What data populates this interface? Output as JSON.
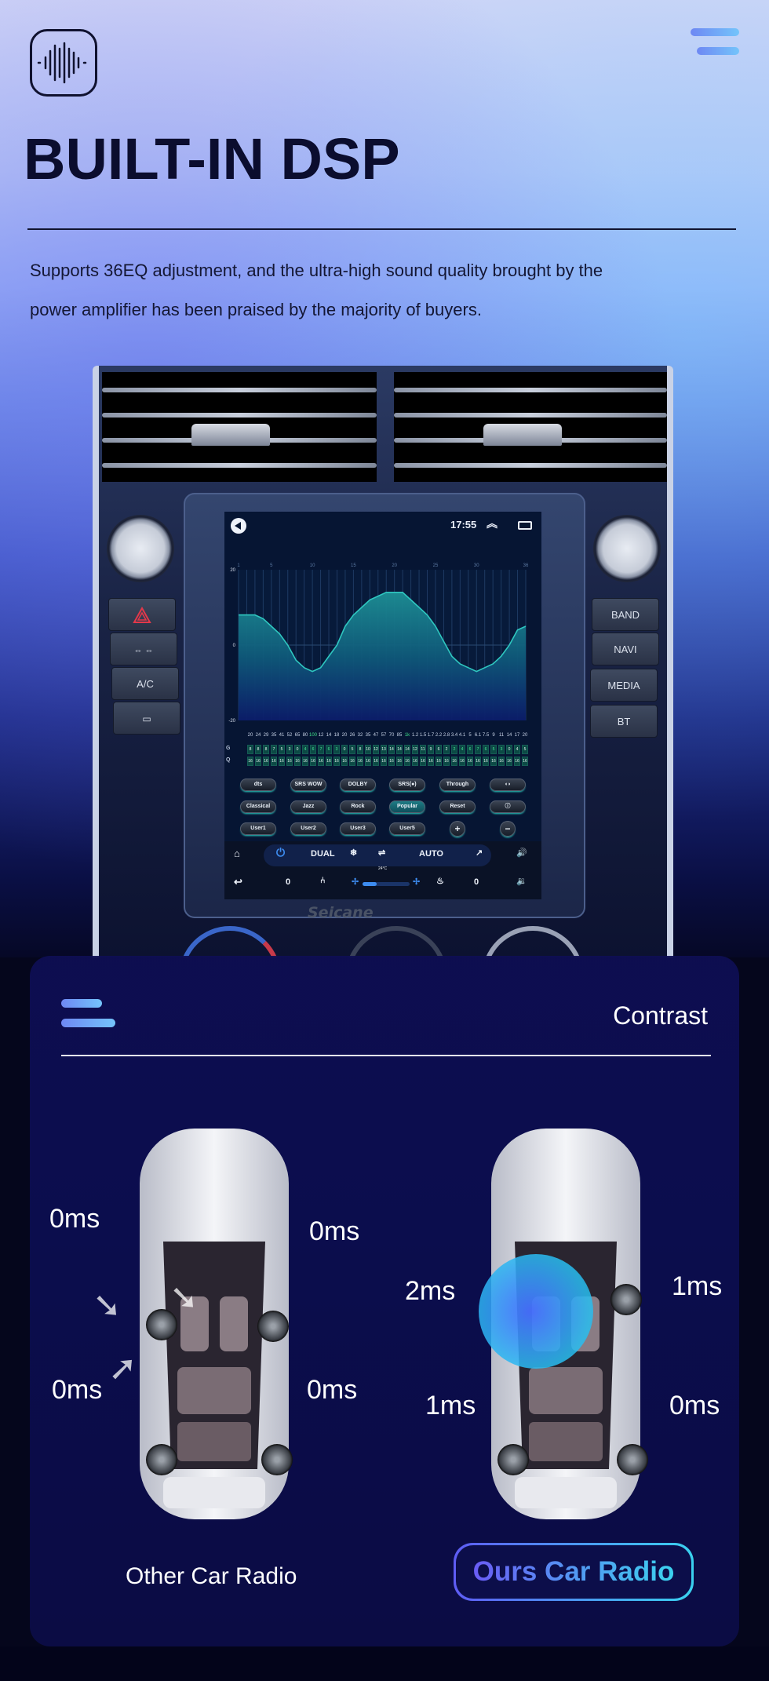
{
  "header": {
    "logo_icon": "sound-wave-icon",
    "menu_icon": "menu-icon",
    "title": "BUILT-IN DSP",
    "description_line1": "Supports 36EQ adjustment, and the ultra-high sound quality brought by the",
    "description_line2": "power amplifier has been praised by the majority of buyers."
  },
  "head_unit": {
    "brand": "Seicane",
    "left_buttons": [
      "hazard",
      "lock-unlock",
      "A/C",
      "rear-defrost"
    ],
    "ac_label": "A/C",
    "right_buttons": [
      "BAND",
      "NAVI",
      "MEDIA",
      "BT"
    ],
    "status_bar": {
      "time": "17:55",
      "icons": [
        "volume-icon",
        "double-chevron-up-icon",
        "recent-apps-icon"
      ]
    },
    "eq": {
      "band_numbers": [
        "1",
        "5",
        "10",
        "15",
        "20",
        "25",
        "30",
        "36"
      ],
      "y_ticks": [
        "20",
        "0",
        "-20"
      ],
      "y_range": [
        -20,
        20
      ],
      "curve_gain_db": [
        8,
        8,
        8,
        7,
        5,
        3,
        0,
        -4,
        -6,
        -7,
        -6,
        -3,
        0,
        5,
        8,
        10,
        12,
        13,
        14,
        14,
        14,
        12,
        10,
        8,
        5,
        1,
        -3,
        -5,
        -6,
        -7,
        -6,
        -5,
        -3,
        0,
        4,
        5
      ],
      "freq_labels": [
        "20",
        "24",
        "29",
        "35",
        "41",
        "52",
        "65",
        "80",
        "100",
        "12",
        "14",
        "18",
        "20",
        "26",
        "32",
        "35",
        "47",
        "57",
        "70",
        "85",
        "1k",
        "1.2",
        "1.5",
        "1.7",
        "2.2",
        "2.8",
        "3.4",
        "4.1",
        "5",
        "6.1",
        "7.5",
        "9",
        "11",
        "14",
        "17",
        "20"
      ],
      "highlighted_freqs": [
        8,
        20
      ],
      "g_label": "G",
      "q_label": "Q",
      "g_values": [
        "8",
        "8",
        "8",
        "7",
        "5",
        "3",
        "0",
        "4",
        "6",
        "7",
        "6",
        "3",
        "0",
        "5",
        "8",
        "10",
        "12",
        "13",
        "14",
        "14",
        "14",
        "12",
        "11",
        "9",
        "6",
        "2",
        "2",
        "4",
        "6",
        "7",
        "6",
        "5",
        "3",
        "0",
        "4",
        "5"
      ],
      "g_highlighted_range": [
        7,
        11,
        26,
        32
      ],
      "q_values": [
        "16",
        "16",
        "16",
        "16",
        "16",
        "16",
        "16",
        "16",
        "16",
        "16",
        "16",
        "16",
        "16",
        "16",
        "16",
        "16",
        "16",
        "16",
        "16",
        "16",
        "16",
        "16",
        "16",
        "16",
        "16",
        "16",
        "16",
        "16",
        "16",
        "16",
        "16",
        "16",
        "16",
        "16",
        "16",
        "16"
      ]
    },
    "eq_buttons_row1": [
      "dts",
      "SRS WOW",
      "DOLBY",
      "SRS(●)",
      "Through",
      "◖◗"
    ],
    "eq_buttons_row2": [
      "Classical",
      "Jazz",
      "Rock",
      "Popular",
      "Reset",
      "ⓘ"
    ],
    "eq_buttons_row3": [
      "User1",
      "User2",
      "User3",
      "User5",
      "+",
      "−"
    ],
    "active_preset": "Popular",
    "climate": {
      "dual": "DUAL",
      "auto": "AUTO",
      "temp": "24°C",
      "left_value": "0",
      "right_value": "0",
      "fan_level": 0.3
    }
  },
  "contrast": {
    "title": "Contrast",
    "other": {
      "label": "Other Car Radio",
      "front_left": "0ms",
      "front_right": "0ms",
      "rear_left": "0ms",
      "rear_right": "0ms"
    },
    "ours": {
      "label": "Ours Car Radio",
      "front_left": "2ms",
      "front_right": "1ms",
      "rear_left": "1ms",
      "rear_right": "0ms"
    }
  },
  "colors": {
    "title": "#0b0d2e",
    "accent_gradient_start": "#5e5cf4",
    "accent_gradient_end": "#3ad1ef",
    "card_bg": "#0b0d4d",
    "eq_curve": "#2fc7c0"
  }
}
